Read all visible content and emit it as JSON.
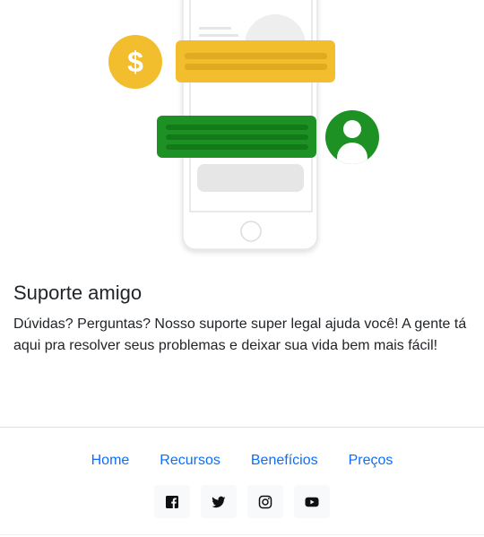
{
  "feature": {
    "title": "Suporte amigo",
    "text": "Dúvidas? Perguntas? Nosso suporte super legal ajuda você! A gente tá aqui pra resolver seus problemas e deixar sua vida bem mais fácil!"
  },
  "footer": {
    "links": [
      "Home",
      "Recursos",
      "Benefícios",
      "Preços"
    ],
    "social_icons": [
      "facebook-icon",
      "twitter-icon",
      "instagram-icon",
      "youtube-icon"
    ]
  },
  "colors": {
    "accent_yellow": "#f2be2d",
    "accent_green": "#1e9125",
    "link_blue": "#0d6efd"
  },
  "illustration": {
    "currency_symbol": "$"
  }
}
